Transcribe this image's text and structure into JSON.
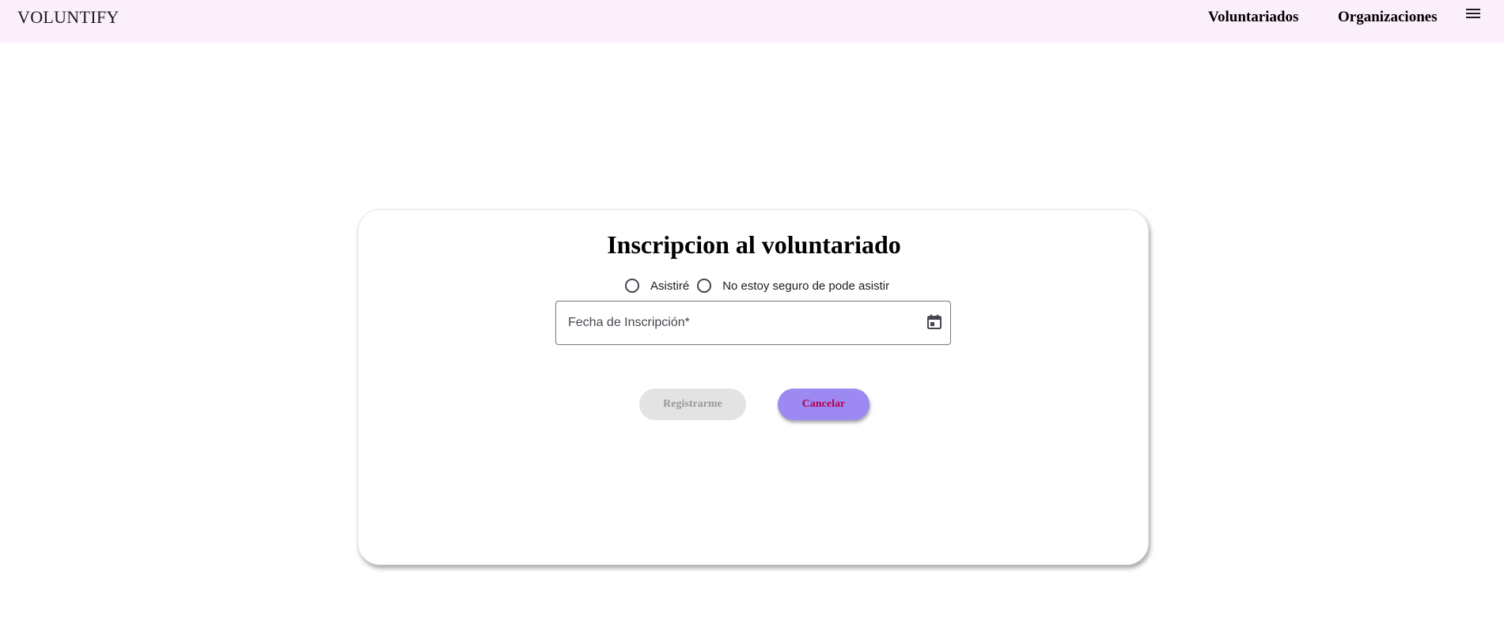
{
  "header": {
    "brand": "VOLUNTIFY",
    "nav": {
      "voluntariados": "Voluntariados",
      "organizaciones": "Organizaciones"
    },
    "menu_icon": "hamburger-menu-icon"
  },
  "form": {
    "title": "Inscripcion al voluntariado",
    "radio_options": {
      "attend": "Asistiré",
      "unsure": "No estoy seguro de pode asistir"
    },
    "date_field": {
      "label": "Fecha de Inscripción*",
      "value": "",
      "icon": "calendar-icon"
    },
    "buttons": {
      "register": "Registrarme",
      "cancel": "Cancelar"
    }
  },
  "colors": {
    "header_bg": "#fbeffb",
    "cancel_bg": "#9c89f2",
    "cancel_text": "#b5004f",
    "disabled_bg": "#e3e3e3",
    "disabled_text": "#9a9a9a"
  }
}
